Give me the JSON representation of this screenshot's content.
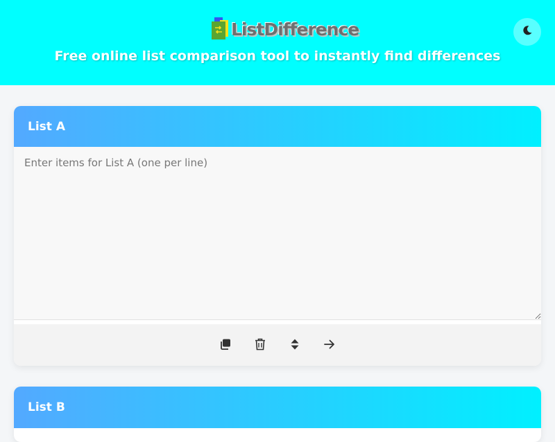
{
  "header": {
    "logo_text": "ListDifference",
    "tagline": "Free online list comparison tool to instantly find differences",
    "theme_toggle_icon": "moon-icon"
  },
  "lists": [
    {
      "title": "List A",
      "placeholder": "Enter items for List A (one per line)",
      "value": "",
      "tools": [
        {
          "icon": "copy-icon"
        },
        {
          "icon": "trash-icon"
        },
        {
          "icon": "sort-icon"
        },
        {
          "icon": "arrow-right-icon"
        }
      ]
    },
    {
      "title": "List B"
    }
  ],
  "colors": {
    "header_bg": "#00ffff",
    "card_gradient_start": "#53a9ff",
    "card_gradient_end": "#00f0ff"
  }
}
